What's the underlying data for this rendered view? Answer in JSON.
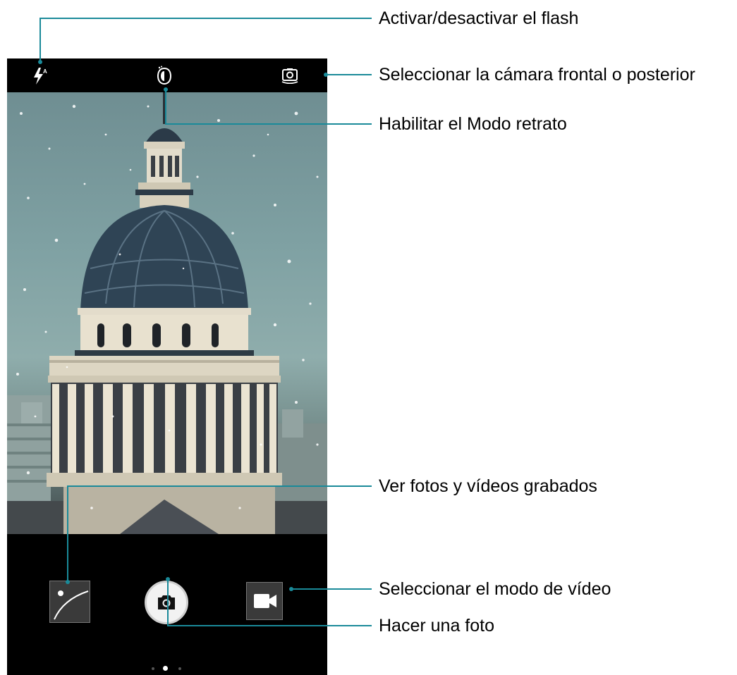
{
  "camera": {
    "flash_icon": "flash-auto-icon",
    "portrait_icon": "portrait-mode-icon",
    "switch_icon": "switch-camera-icon",
    "gallery_icon": "gallery-thumbnail-icon",
    "shutter_icon": "camera-icon",
    "video_icon": "video-camera-icon",
    "mode_pages": 3,
    "active_mode_page": 2
  },
  "callouts": {
    "flash": "Activar/desactivar el flash",
    "switch_camera": "Seleccionar la cámara frontal o posterior",
    "portrait": "Habilitar el Modo retrato",
    "gallery": "Ver fotos y vídeos grabados",
    "video_mode": "Seleccionar el modo de vídeo",
    "take_photo": "Hacer una foto"
  },
  "colors": {
    "callout_line": "#1a8a99",
    "bar": "#000000",
    "sky": "#7fa1a3",
    "dome": "#2f4455"
  }
}
